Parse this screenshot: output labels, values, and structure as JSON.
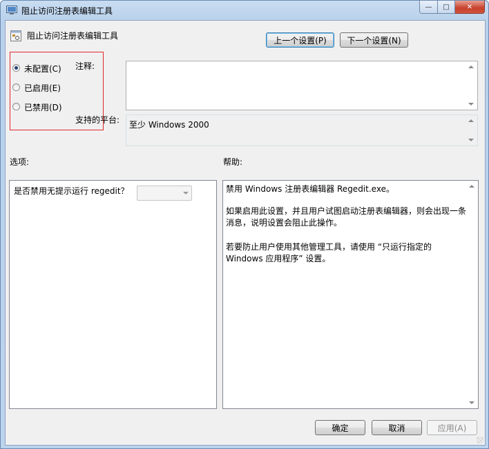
{
  "window": {
    "title": "阻止访问注册表编辑工具",
    "minimize_glyph": "—",
    "maximize_glyph": "□",
    "close_glyph": "✕"
  },
  "header": {
    "setting_name": "阻止访问注册表编辑工具",
    "prev_button": "上一个设置(P)",
    "next_button": "下一个设置(N)"
  },
  "state": {
    "options": [
      {
        "label": "未配置(C)",
        "checked": true
      },
      {
        "label": "已启用(E)",
        "checked": false
      },
      {
        "label": "已禁用(D)",
        "checked": false
      }
    ]
  },
  "comment": {
    "label": "注释:",
    "value": ""
  },
  "platform": {
    "label": "支持的平台:",
    "value": "至少 Windows 2000"
  },
  "options_section": {
    "label": "选项:",
    "prompt": "是否禁用无提示运行 regedit？",
    "dropdown_value": ""
  },
  "help_section": {
    "label": "帮助:",
    "lines": [
      "禁用 Windows 注册表编辑器 Regedit.exe。",
      "",
      "如果启用此设置，并且用户试图启动注册表编辑器，则会出现一条",
      "消息，说明设置会阻止此操作。",
      "",
      "若要防止用户使用其他管理工具，请使用 “只运行指定的",
      "Windows 应用程序” 设置。"
    ]
  },
  "footer": {
    "ok_button": "确定",
    "cancel_button": "取消",
    "apply_button": "应用(A)"
  },
  "colors": {
    "highlight_box": "#e0262b",
    "titlebar": "#bcd3ee",
    "close_button": "#c7402b"
  }
}
